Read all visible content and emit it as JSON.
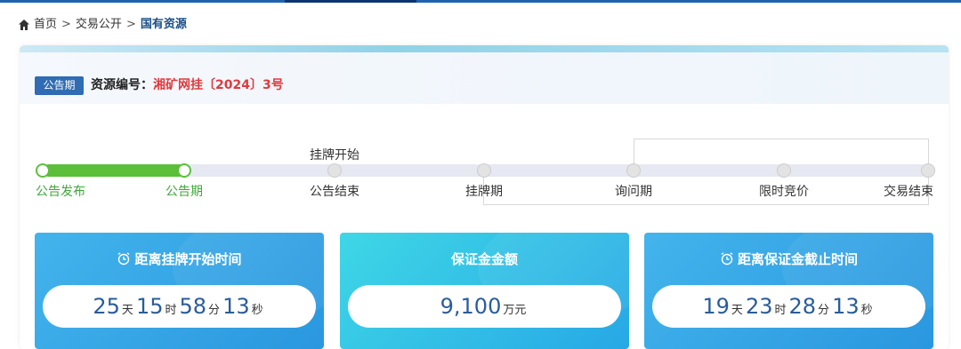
{
  "breadcrumb": {
    "home": "首页",
    "sep": ">",
    "level2": "交易公开",
    "current": "国有资源"
  },
  "header": {
    "badge": "公告期",
    "resource_label": "资源编号：",
    "resource_value": "湘矿网挂〔2024〕3号"
  },
  "timeline": {
    "top_label": "挂牌开始",
    "steps": [
      {
        "label": "公告发布",
        "done": true
      },
      {
        "label": "公告期",
        "done": true
      },
      {
        "label": "公告结束",
        "done": false
      },
      {
        "label": "挂牌期",
        "done": false
      },
      {
        "label": "询问期",
        "done": false
      },
      {
        "label": "限时竞价",
        "done": false
      },
      {
        "label": "交易结束",
        "done": false
      }
    ]
  },
  "cards": [
    {
      "title": "距离挂牌开始时间",
      "icon": "alarm-clock-icon",
      "days": "25",
      "hours": "15",
      "minutes": "58",
      "seconds": "13"
    },
    {
      "title": "保证金金额",
      "amount": "9,100",
      "unit": "万元"
    },
    {
      "title": "距离保证金截止时间",
      "icon": "alarm-clock-icon",
      "days": "19",
      "hours": "23",
      "minutes": "28",
      "seconds": "13"
    }
  ],
  "units": {
    "day": "天",
    "hour": "时",
    "minute": "分",
    "second": "秒"
  },
  "colors": {
    "accent": "#2f6cb3",
    "progress": "#5bbf3a",
    "highlight": "#e0393e",
    "card_blue": "#2a97df",
    "card_cyan": "#3fd7e6"
  }
}
